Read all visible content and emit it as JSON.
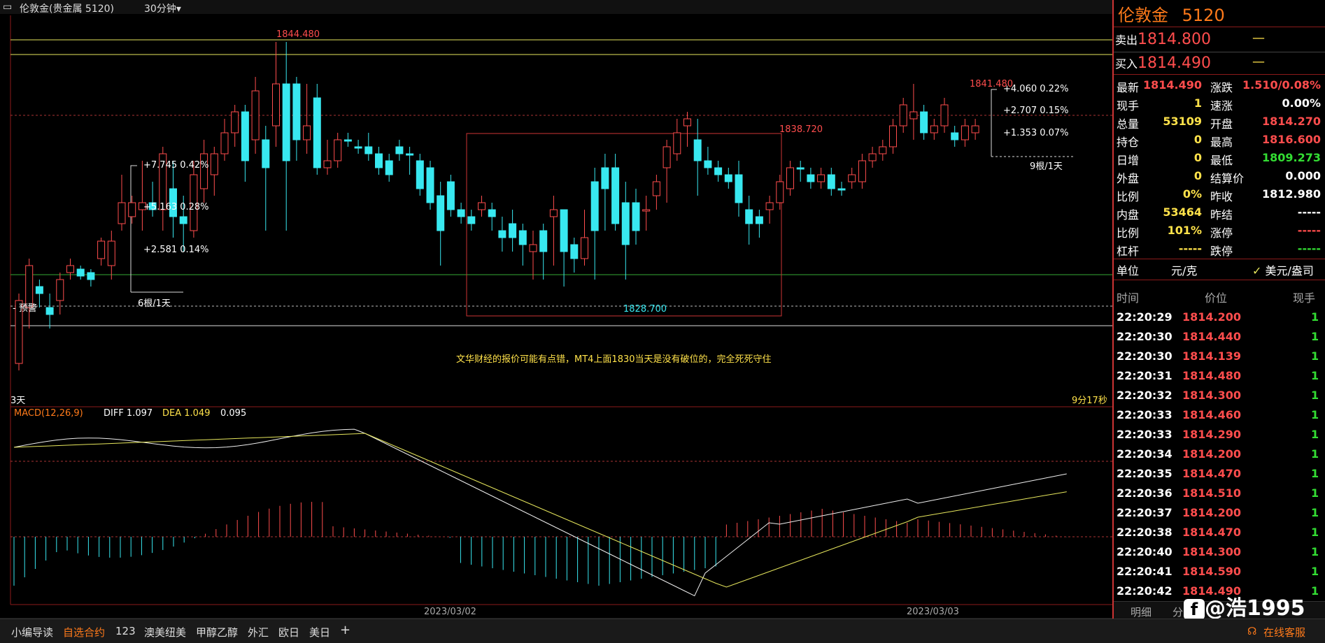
{
  "title_bar": {
    "icon": "window-icon",
    "instrument": "伦敦金(贵金属 5120)",
    "period": "30分钟"
  },
  "chart": {
    "labels": {
      "high_left": "1844.480",
      "high_mid": "1838.720",
      "high_right": "1841.480",
      "low_mid": "1828.700",
      "left_box_1": "+7.745  0.42%",
      "left_box_2": "+5.163  0.28%",
      "left_box_3": "+2.581  0.14%",
      "left_box_count": "6根/1天",
      "right_box_1": "+4.060  0.22%",
      "right_box_2": "+2.707  0.15%",
      "right_box_3": "+1.353  0.07%",
      "right_box_count": "9根/1天",
      "alert": "预警",
      "annotation": "文华财经的报价可能有点错，MT4上面1830当天是没有破位的，完全死死守住",
      "bottom_left": "3天",
      "bottom_right": "9分17秒"
    },
    "macd": {
      "name": "MACD(12,26,9)",
      "diff": "DIFF 1.097",
      "dea": "DEA 1.049",
      "macd": "0.095"
    },
    "date_axis": [
      "2023/03/02",
      "2023/03/03"
    ]
  },
  "quote": {
    "name": "伦敦金",
    "code": "5120",
    "sell_label": "卖出",
    "sell_price": "1814.800",
    "sell_vol": "—",
    "buy_label": "买入",
    "buy_price": "1814.490",
    "buy_vol": "—",
    "stats": [
      {
        "l1": "最新",
        "v1": "1814.490",
        "c1": "red",
        "l2": "涨跌",
        "v2": "1.510/0.08%",
        "c2": "red"
      },
      {
        "l1": "现手",
        "v1": "1",
        "c1": "yellow",
        "l2": "速涨",
        "v2": "0.00%",
        "c2": "white"
      },
      {
        "l1": "总量",
        "v1": "53109",
        "c1": "yellow",
        "l2": "开盘",
        "v2": "1814.270",
        "c2": "red"
      },
      {
        "l1": "持仓",
        "v1": "0",
        "c1": "yellow",
        "l2": "最高",
        "v2": "1816.600",
        "c2": "red"
      },
      {
        "l1": "日增",
        "v1": "0",
        "c1": "yellow",
        "l2": "最低",
        "v2": "1809.273",
        "c2": "green"
      },
      {
        "l1": "外盘",
        "v1": "0",
        "c1": "yellow",
        "l2": "结算价",
        "v2": "0.000",
        "c2": "white"
      },
      {
        "l1": "比例",
        "v1": "0%",
        "c1": "yellow",
        "l2": "昨收",
        "v2": "1812.980",
        "c2": "white"
      },
      {
        "l1": "内盘",
        "v1": "53464",
        "c1": "yellow",
        "l2": "昨结",
        "v2": "-----",
        "c2": "white"
      },
      {
        "l1": "比例",
        "v1": "101%",
        "c1": "yellow",
        "l2": "涨停",
        "v2": "-----",
        "c2": "red"
      },
      {
        "l1": "杠杆",
        "v1": "-----",
        "c1": "yellow",
        "l2": "跌停",
        "v2": "-----",
        "c2": "green"
      }
    ],
    "unit_label": "单位",
    "unit_value": "元/克",
    "unit_option": "美元/盎司",
    "ticks_header": {
      "time": "时间",
      "price": "价位",
      "vol": "现手"
    },
    "ticks": [
      {
        "t": "22:20:29",
        "p": "1814.200",
        "v": "1"
      },
      {
        "t": "22:20:30",
        "p": "1814.440",
        "v": "1"
      },
      {
        "t": "22:20:30",
        "p": "1814.139",
        "v": "1"
      },
      {
        "t": "22:20:31",
        "p": "1814.480",
        "v": "1"
      },
      {
        "t": "22:20:32",
        "p": "1814.300",
        "v": "1"
      },
      {
        "t": "22:20:33",
        "p": "1814.460",
        "v": "1"
      },
      {
        "t": "22:20:33",
        "p": "1814.290",
        "v": "1"
      },
      {
        "t": "22:20:34",
        "p": "1814.200",
        "v": "1"
      },
      {
        "t": "22:20:35",
        "p": "1814.470",
        "v": "1"
      },
      {
        "t": "22:20:36",
        "p": "1814.510",
        "v": "1"
      },
      {
        "t": "22:20:37",
        "p": "1814.200",
        "v": "1"
      },
      {
        "t": "22:20:38",
        "p": "1814.470",
        "v": "1"
      },
      {
        "t": "22:20:40",
        "p": "1814.300",
        "v": "1"
      },
      {
        "t": "22:20:41",
        "p": "1814.590",
        "v": "1"
      },
      {
        "t": "22:20:42",
        "p": "1814.490",
        "v": "1"
      }
    ],
    "tabs": [
      "明细",
      "分"
    ],
    "watermark": "@浩1995"
  },
  "bottom_bar": {
    "items": [
      "小编导读",
      "自选合约",
      "123",
      "澳美纽美",
      "甲醇乙醇",
      "外汇",
      "欧日",
      "美日"
    ],
    "active": "自选合约",
    "add": "+",
    "service": "在线客服"
  },
  "colors": {
    "up": "#ff4d4d",
    "down": "#38e8f0",
    "accent": "#ff7a1a"
  }
}
